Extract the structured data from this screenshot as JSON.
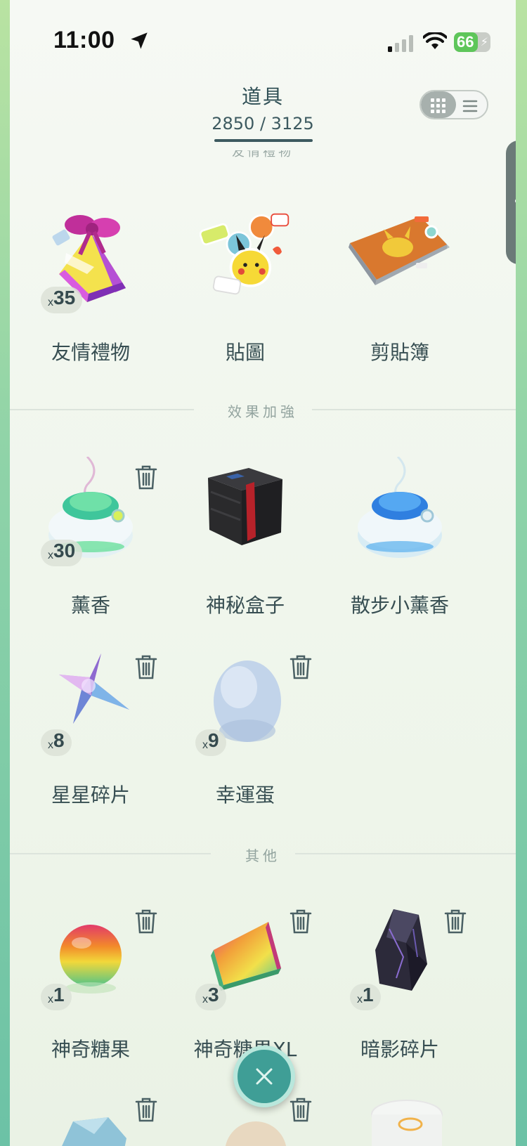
{
  "status": {
    "time": "11:00",
    "battery": "66",
    "battery_level": 0.66
  },
  "header": {
    "title": "道具",
    "count": "2850 / 3125",
    "faded_section": "友情禮物"
  },
  "sections": {
    "boost": "效果加強",
    "other": "其他"
  },
  "items_top": [
    {
      "label": "友情禮物",
      "qty": "35"
    },
    {
      "label": "貼圖"
    },
    {
      "label": "剪貼簿"
    }
  ],
  "items_boost": [
    {
      "label": "薰香",
      "qty": "30"
    },
    {
      "label": "神秘盒子"
    },
    {
      "label": "散步小薰香"
    },
    {
      "label": "星星碎片",
      "qty": "8"
    },
    {
      "label": "幸運蛋",
      "qty": "9"
    }
  ],
  "items_other": [
    {
      "label": "神奇糖果",
      "qty": "1"
    },
    {
      "label": "神奇糖果XL",
      "qty": "3"
    },
    {
      "label": "暗影碎片",
      "qty": "1"
    }
  ],
  "qty_prefix": "x",
  "colors": {
    "accent": "#3f9e96",
    "text": "#374e52",
    "battery": "#5ec65a"
  }
}
